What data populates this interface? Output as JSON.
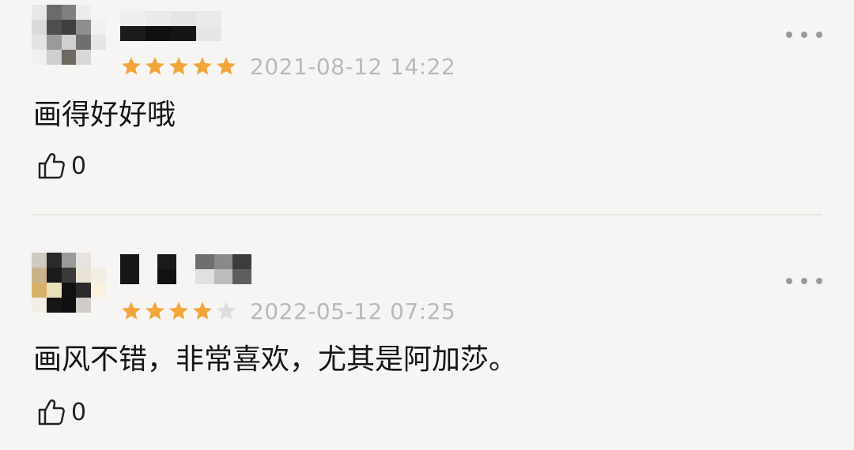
{
  "colors": {
    "background": "#f6f5f3",
    "star_filled": "#f2a53a",
    "star_empty": "#dddddd",
    "timestamp": "#b9b9b9",
    "divider": "#e5e4e1"
  },
  "comments": [
    {
      "rating": 5,
      "timestamp": "2021-08-12 14:22",
      "text": "画得好好哦",
      "likes": "0",
      "icons": [
        "avatar",
        "star-icon",
        "more-icon",
        "thumbs-up-icon"
      ]
    },
    {
      "rating": 4,
      "timestamp": "2022-05-12 07:25",
      "text": "画风不错，非常喜欢，尤其是阿加莎。",
      "likes": "0",
      "icons": [
        "avatar",
        "star-icon",
        "more-icon",
        "thumbs-up-icon"
      ]
    }
  ]
}
